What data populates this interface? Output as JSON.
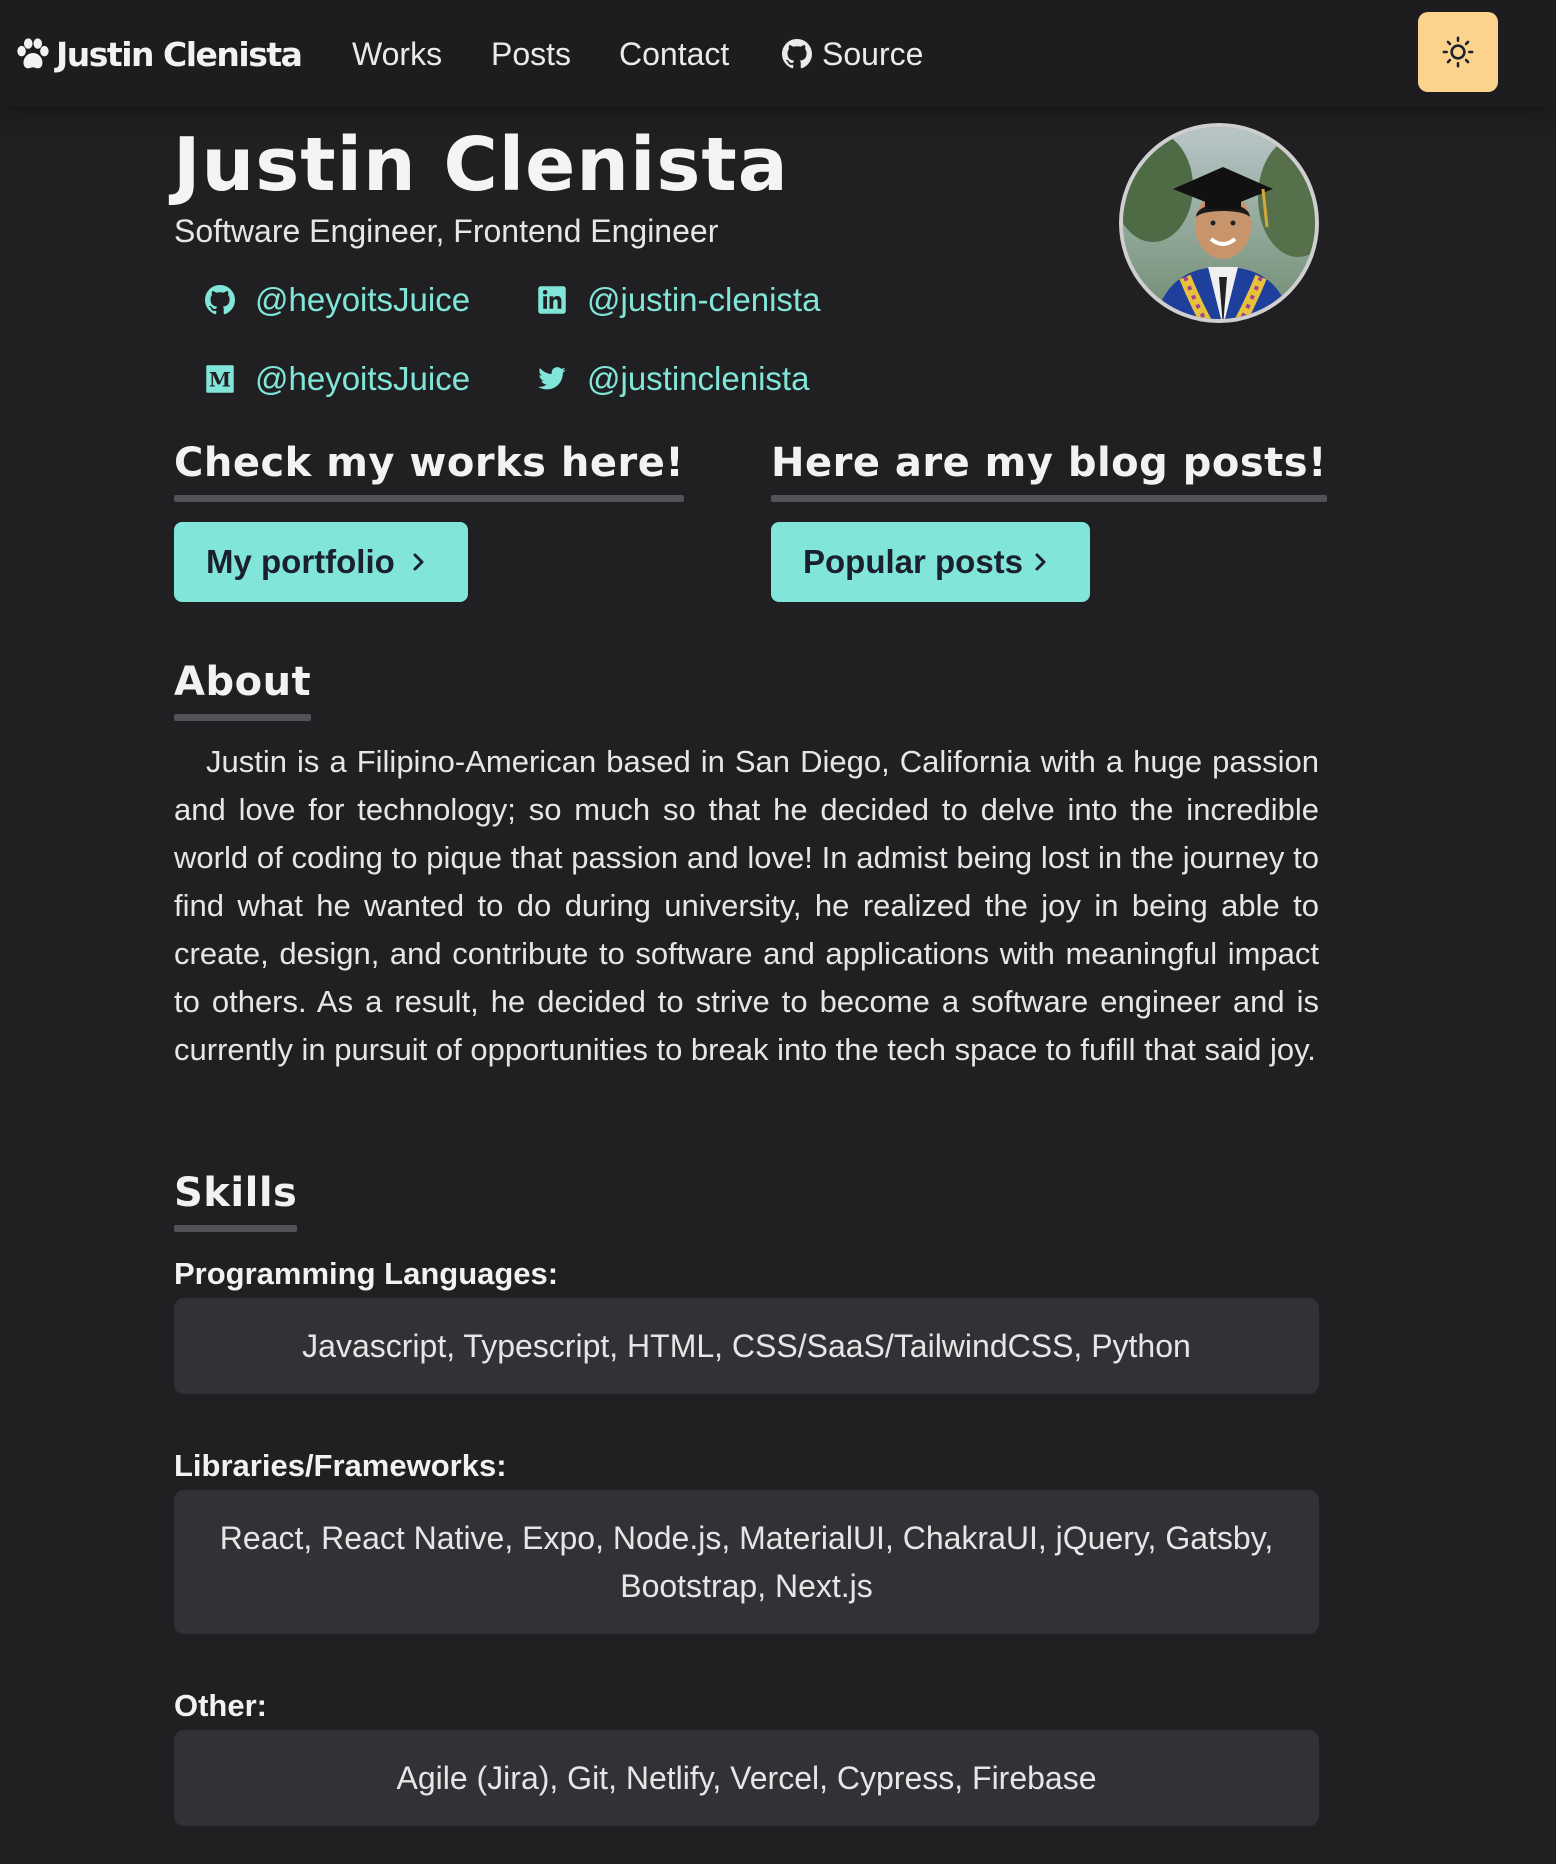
{
  "nav": {
    "logo_text": "Justin Clenista",
    "links": [
      {
        "label": "Works"
      },
      {
        "label": "Posts"
      },
      {
        "label": "Contact"
      },
      {
        "label": "Source"
      }
    ]
  },
  "hero": {
    "name": "Justin Clenista",
    "subtitle": "Software Engineer, Frontend Engineer",
    "socials": [
      {
        "icon": "github-icon",
        "handle": "@heyoitsJuice"
      },
      {
        "icon": "linkedin-icon",
        "handle": "@justin-clenista"
      },
      {
        "icon": "medium-icon",
        "handle": "@heyoitsJuice"
      },
      {
        "icon": "twitter-icon",
        "handle": "@justinclenista"
      }
    ]
  },
  "works": {
    "heading": "Check my works here!",
    "button": "My portfolio"
  },
  "blog": {
    "heading": "Here are my blog posts!",
    "button": "Popular posts"
  },
  "about": {
    "heading": "About",
    "body": "Justin is a Filipino-American based in San Diego, California with a huge passion and love for technology; so much so that he decided to delve into the incredible world of coding to pique that passion and love! In admist being lost in the journey to find what he wanted to do during university, he realized the joy in being able to create, design, and contribute to software and applications with meaningful impact to others. As a result, he decided to strive to become a software engineer and is currently in pursuit of opportunities to break into the tech space to fufill that said joy."
  },
  "skills": {
    "heading": "Skills",
    "groups": [
      {
        "label": "Programming Languages:",
        "items": "Javascript, Typescript, HTML, CSS/SaaS/TailwindCSS, Python"
      },
      {
        "label": "Libraries/Frameworks:",
        "items": "React, React Native, Expo, Node.js, MaterialUI, ChakraUI, jQuery, Gatsby, Bootstrap, Next.js"
      },
      {
        "label": "Other:",
        "items": "Agile (Jira), Git, Netlify, Vercel, Cypress, Firebase"
      }
    ]
  },
  "colors": {
    "background": "#202023",
    "accent": "#81e6d9",
    "toggle": "#fbd38d"
  }
}
